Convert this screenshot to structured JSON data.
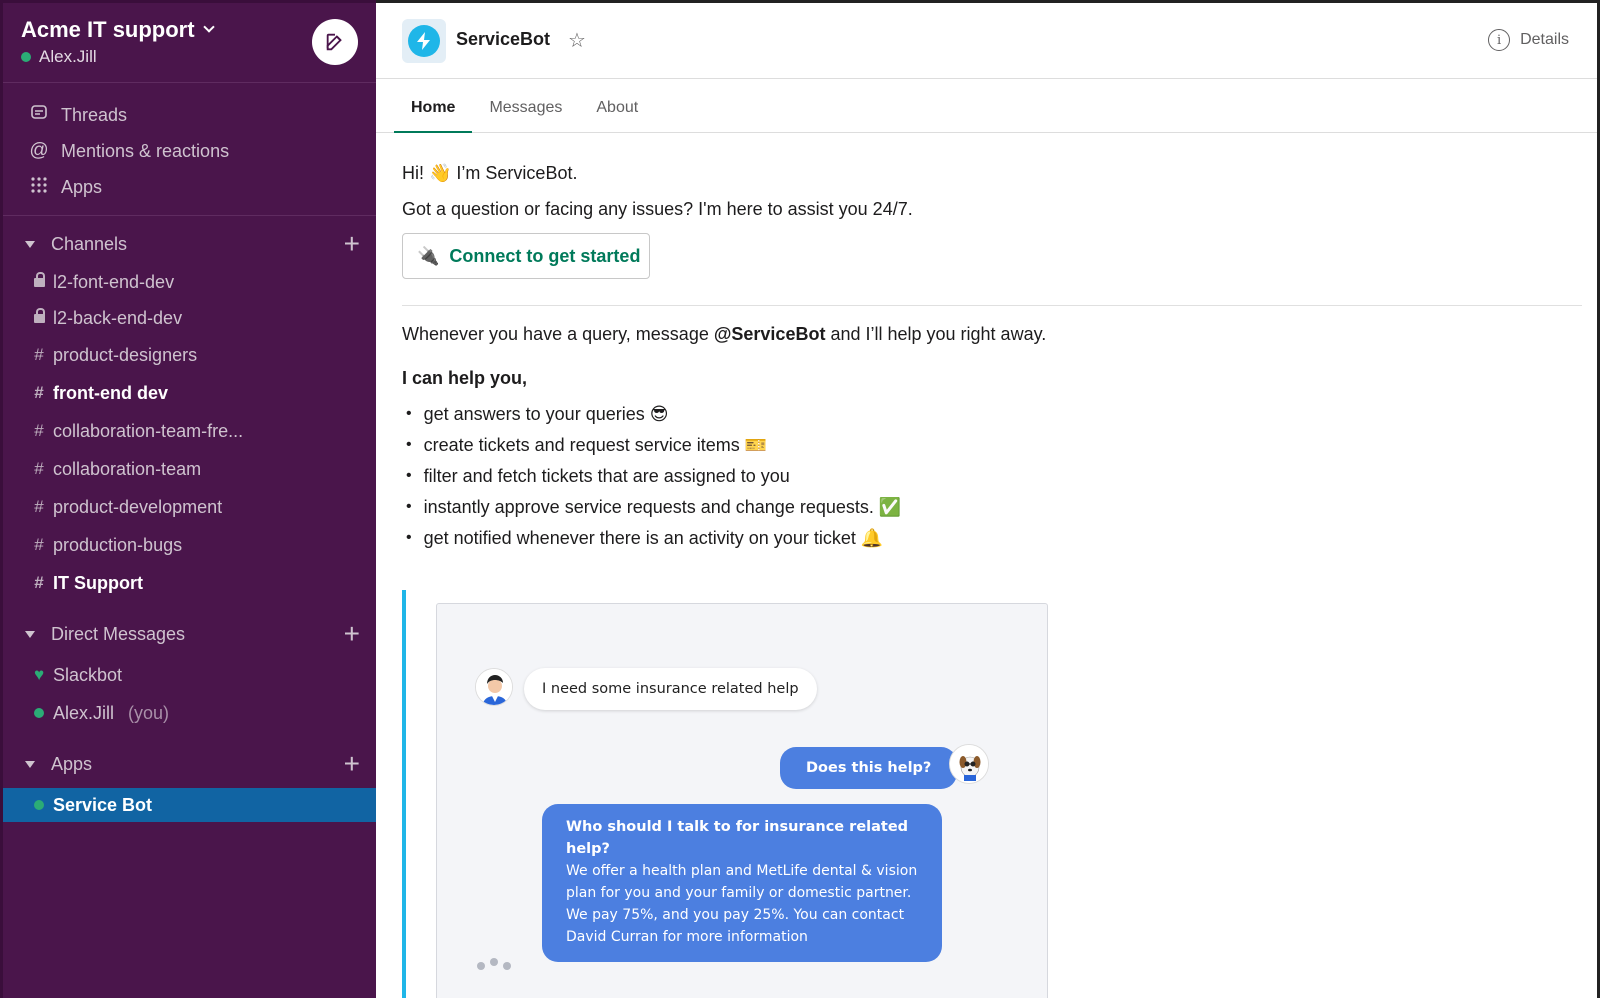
{
  "workspace": {
    "name": "Acme IT support",
    "user": "Alex.Jill"
  },
  "nav": [
    {
      "label": "Threads",
      "icon": "threads-icon"
    },
    {
      "label": "Mentions & reactions",
      "icon": "at-icon"
    },
    {
      "label": "Apps",
      "icon": "apps-grid-icon"
    }
  ],
  "channels": {
    "title": "Channels",
    "items": [
      {
        "label": "l2-font-end-dev",
        "private": true
      },
      {
        "label": "l2-back-end-dev",
        "private": true
      },
      {
        "label": "product-designers"
      },
      {
        "label": "front-end dev",
        "bold": true
      },
      {
        "label": "collaboration-team-fre..."
      },
      {
        "label": "collaboration-team"
      },
      {
        "label": "product-development"
      },
      {
        "label": "production-bugs"
      },
      {
        "label": "IT Support",
        "bold": true
      }
    ]
  },
  "direct_messages": {
    "title": "Direct Messages",
    "items": [
      {
        "label": "Slackbot",
        "suffix": ""
      },
      {
        "label": "Alex.Jill",
        "suffix": "(you)"
      }
    ]
  },
  "apps": {
    "title": "Apps",
    "items": [
      {
        "label": "Service Bot"
      }
    ]
  },
  "header": {
    "bot_name": "ServiceBot",
    "details_label": "Details"
  },
  "tabs": [
    "Home",
    "Messages",
    "About"
  ],
  "home": {
    "greeting_pre": "Hi! ",
    "greeting_emoji": "👋",
    "greeting_post": " I’m ServiceBot.",
    "intro": "Got a question or facing any issues? I'm here to assist you 24/7.",
    "connect_emoji": "🔌",
    "connect_label": "Connect to get started",
    "query_pre": "Whenever you have a query, message ",
    "query_mention": "@ServiceBot",
    "query_post": " and I’ll help you right away.",
    "help_title": "I can help you,",
    "help_items": [
      "get answers to your queries 😎",
      "create tickets and request service items 🎫",
      "filter and fetch tickets that are assigned to you",
      "instantly approve service requests and change requests. ✅",
      "get notified whenever there is an activity on your ticket 🔔"
    ]
  },
  "preview": {
    "user_message": "I need some insurance related help",
    "bot_message_1": "Does this help?",
    "bot_question": "Who should I talk to for insurance related help?",
    "bot_answer_lines": [
      "We offer a health plan and MetLife dental & vision",
      "plan for you and your family or domestic partner.",
      "We pay 75%, and you pay 25%. You can contact",
      "David Curran for more information"
    ]
  },
  "colors": {
    "sidebar": "#4a154b",
    "active": "#1164a3",
    "accent": "#007a5a",
    "bot_bubble": "#4c7fe0",
    "quote_bar": "#1fb6e8"
  }
}
